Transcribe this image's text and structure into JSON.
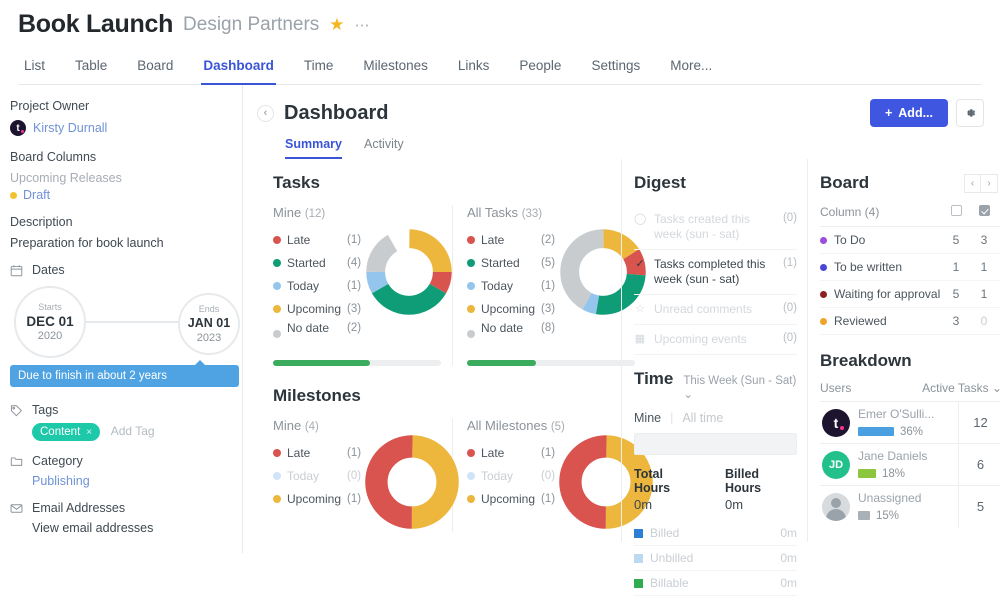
{
  "header": {
    "project_title": "Book Launch",
    "project_subtitle": "Design Partners",
    "star_icon": "star-icon",
    "more_icon": "ellipsis-icon",
    "tabs": [
      {
        "label": "List",
        "active": false
      },
      {
        "label": "Table",
        "active": false
      },
      {
        "label": "Board",
        "active": false
      },
      {
        "label": "Dashboard",
        "active": true
      },
      {
        "label": "Time",
        "active": false
      },
      {
        "label": "Milestones",
        "active": false
      },
      {
        "label": "Links",
        "active": false
      },
      {
        "label": "People",
        "active": false
      },
      {
        "label": "Settings",
        "active": false
      },
      {
        "label": "More...",
        "active": false
      }
    ]
  },
  "sidebar": {
    "project_owner_label": "Project Owner",
    "owner_name": "Kirsty Durnall",
    "owner_avatar_initial": "t",
    "board_columns_label": "Board Columns",
    "board_columns_group": "Upcoming Releases",
    "board_column_item": "Draft",
    "board_column_color": "#f0c330",
    "description_label": "Description",
    "description_text": "Preparation for book launch",
    "dates_label": "Dates",
    "dates_icon": "calendar-icon",
    "start_label": "Starts",
    "start_date": "DEC 01",
    "start_year": "2020",
    "end_label": "Ends",
    "end_date": "JAN 01",
    "end_year": "2023",
    "due_banner": "Due to finish in about 2 years",
    "tags_label": "Tags",
    "tags_icon": "tag-icon",
    "tag_value": "Content",
    "tag_remove": "×",
    "add_tag": "Add Tag",
    "category_label": "Category",
    "category_icon": "folder-icon",
    "category_value": "Publishing",
    "email_label": "Email Addresses",
    "email_icon": "envelope-icon",
    "email_link": "View email addresses"
  },
  "content": {
    "back_icon": "chevron-left-icon",
    "title": "Dashboard",
    "add_button": "Add...",
    "add_icon": "plus-icon",
    "gear_icon": "gear-icon",
    "sub_tabs": [
      {
        "label": "Summary",
        "active": true
      },
      {
        "label": "Activity",
        "active": false
      }
    ]
  },
  "tasks": {
    "title": "Tasks",
    "panes": [
      {
        "heading": "Mine",
        "count": "(12)",
        "progress_pct": 58,
        "legend": [
          {
            "label": "Late",
            "value": "(1)",
            "color": "#d9534f",
            "faded": false
          },
          {
            "label": "Started",
            "value": "(4)",
            "color": "#0f9d77",
            "faded": false
          },
          {
            "label": "Today",
            "value": "(1)",
            "color": "#93c5ed",
            "faded": false
          },
          {
            "label": "Upcoming",
            "value": "(3)",
            "color": "#edb73e",
            "faded": false
          },
          {
            "label": "No date",
            "value": "(2)",
            "color": "#c8ccce",
            "faded": false
          }
        ]
      },
      {
        "heading": "All Tasks",
        "count": "(33)",
        "progress_pct": 41,
        "legend": [
          {
            "label": "Late",
            "value": "(2)",
            "color": "#d9534f",
            "faded": false
          },
          {
            "label": "Started",
            "value": "(5)",
            "color": "#0f9d77",
            "faded": false
          },
          {
            "label": "Today",
            "value": "(1)",
            "color": "#93c5ed",
            "faded": false
          },
          {
            "label": "Upcoming",
            "value": "(3)",
            "color": "#edb73e",
            "faded": false
          },
          {
            "label": "No date",
            "value": "(8)",
            "color": "#c8ccce",
            "faded": false
          }
        ]
      }
    ]
  },
  "milestones": {
    "title": "Milestones",
    "panes": [
      {
        "heading": "Mine",
        "count": "(4)",
        "legend": [
          {
            "label": "Late",
            "value": "(1)",
            "color": "#d9534f",
            "faded": false
          },
          {
            "label": "Today",
            "value": "(0)",
            "color": "#cfe5f7",
            "faded": true
          },
          {
            "label": "Upcoming",
            "value": "(1)",
            "color": "#edb73e",
            "faded": false
          }
        ]
      },
      {
        "heading": "All Milestones",
        "count": "(5)",
        "legend": [
          {
            "label": "Late",
            "value": "(1)",
            "color": "#d9534f",
            "faded": false
          },
          {
            "label": "Today",
            "value": "(0)",
            "color": "#cfe5f7",
            "faded": true
          },
          {
            "label": "Upcoming",
            "value": "(1)",
            "color": "#edb73e",
            "faded": false
          }
        ]
      }
    ]
  },
  "digest": {
    "title": "Digest",
    "rows": [
      {
        "icon": "circle-plus-icon",
        "text": "Tasks created this week (sun - sat)",
        "count": "(0)",
        "faded": true
      },
      {
        "icon": "check-circle-icon",
        "text": "Tasks completed this week (sun - sat)",
        "count": "(1)",
        "faded": false
      },
      {
        "icon": "comment-icon",
        "text": "Unread comments",
        "count": "(0)",
        "faded": true
      },
      {
        "icon": "calendar-icon",
        "text": "Upcoming events",
        "count": "(0)",
        "faded": true
      }
    ]
  },
  "time": {
    "title": "Time",
    "range_selector": "This Week (Sun - Sat)",
    "chevron_icon": "chevron-down-icon",
    "tab_mine": "Mine",
    "tab_alltime": "All time",
    "total_hours_label": "Total Hours",
    "total_hours_value": "0m",
    "billed_hours_label": "Billed Hours",
    "billed_hours_value": "0m",
    "rows": [
      {
        "label": "Billed",
        "value": "0m",
        "color": "#2b7fd4"
      },
      {
        "label": "Unbilled",
        "value": "0m",
        "color": "#bcd9f2"
      },
      {
        "label": "Billable",
        "value": "0m",
        "color": "#2eac4f"
      }
    ]
  },
  "board": {
    "title": "Board",
    "prev_icon": "chevron-left-icon",
    "next_icon": "chevron-right-icon",
    "column_header": "Column (4)",
    "rows": [
      {
        "label": "To Do",
        "color": "#9b4ddb",
        "a": "5",
        "b": "3"
      },
      {
        "label": "To be written",
        "color": "#4a46d6",
        "a": "1",
        "b": "1"
      },
      {
        "label": "Waiting for approval",
        "color": "#8f2020",
        "a": "5",
        "b": "1"
      },
      {
        "label": "Reviewed",
        "color": "#f0a32a",
        "a": "3",
        "b": "0"
      }
    ]
  },
  "breakdown": {
    "title": "Breakdown",
    "users_label": "Users",
    "sort_label": "Active Tasks",
    "chevron_icon": "chevron-down-icon",
    "rows": [
      {
        "name": "Emer O'Sulli...",
        "initials": "t",
        "avatar_type": "logo",
        "pct": "36%",
        "pct_num": 36,
        "bar_color": "#4a9fe0",
        "value": "12"
      },
      {
        "name": "Jane Daniels",
        "initials": "JD",
        "avatar_type": "initials",
        "avatar_color": "#22c08a",
        "pct": "18%",
        "pct_num": 18,
        "bar_color": "#8cc63f",
        "value": "6"
      },
      {
        "name": "Unassigned",
        "initials": "",
        "avatar_type": "ghost",
        "pct": "15%",
        "pct_num": 15,
        "bar_color": "#a9b0b6",
        "value": "5"
      }
    ]
  },
  "chart_data": [
    {
      "type": "pie",
      "title": "Tasks - Mine (12)",
      "categories": [
        "Late",
        "Started",
        "Today",
        "Upcoming",
        "No date"
      ],
      "values": [
        1,
        4,
        1,
        3,
        2
      ],
      "colors": [
        "#d9534f",
        "#0f9d77",
        "#93c5ed",
        "#edb73e",
        "#c8ccce"
      ]
    },
    {
      "type": "pie",
      "title": "Tasks - All Tasks (33)",
      "categories": [
        "Late",
        "Started",
        "Today",
        "Upcoming",
        "No date"
      ],
      "values": [
        2,
        5,
        1,
        3,
        8
      ],
      "colors": [
        "#d9534f",
        "#0f9d77",
        "#93c5ed",
        "#edb73e",
        "#c8ccce"
      ]
    },
    {
      "type": "pie",
      "title": "Milestones - Mine (4)",
      "categories": [
        "Late",
        "Today",
        "Upcoming"
      ],
      "values": [
        1,
        0,
        1
      ],
      "colors": [
        "#d9534f",
        "#cfe5f7",
        "#edb73e"
      ]
    },
    {
      "type": "pie",
      "title": "Milestones - All Milestones (5)",
      "categories": [
        "Late",
        "Today",
        "Upcoming"
      ],
      "values": [
        1,
        0,
        1
      ],
      "colors": [
        "#d9534f",
        "#cfe5f7",
        "#edb73e"
      ]
    },
    {
      "type": "bar",
      "title": "Breakdown - Active Tasks by User",
      "categories": [
        "Emer O'Sulli...",
        "Jane Daniels",
        "Unassigned"
      ],
      "values": [
        12,
        6,
        5
      ],
      "percentages": [
        36,
        18,
        15
      ]
    }
  ]
}
